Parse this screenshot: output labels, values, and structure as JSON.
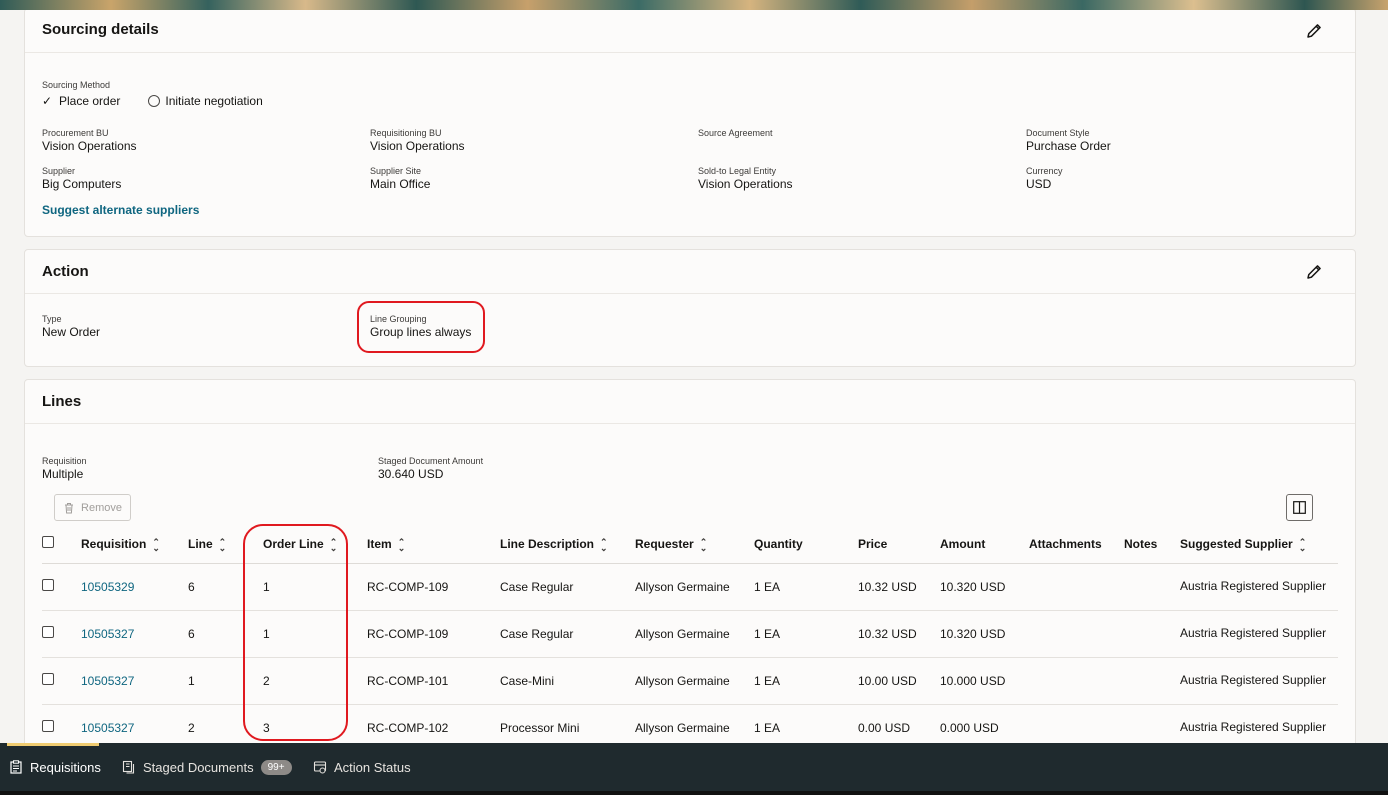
{
  "sourcing": {
    "title": "Sourcing details",
    "method_label": "Sourcing Method",
    "option_selected": "Place order",
    "option_other": "Initiate negotiation",
    "fields": [
      {
        "label": "Procurement BU",
        "value": "Vision Operations"
      },
      {
        "label": "Requisitioning BU",
        "value": "Vision Operations"
      },
      {
        "label": "Source Agreement",
        "value": ""
      },
      {
        "label": "Document Style",
        "value": "Purchase Order"
      },
      {
        "label": "Supplier",
        "value": "Big Computers"
      },
      {
        "label": "Supplier Site",
        "value": "Main Office"
      },
      {
        "label": "Sold-to Legal Entity",
        "value": "Vision Operations"
      },
      {
        "label": "Currency",
        "value": "USD"
      }
    ],
    "suggest_link": "Suggest alternate suppliers"
  },
  "action": {
    "title": "Action",
    "type_label": "Type",
    "type_value": "New Order",
    "grouping_label": "Line Grouping",
    "grouping_value": "Group lines always"
  },
  "lines": {
    "title": "Lines",
    "requisition_label": "Requisition",
    "requisition_value": "Multiple",
    "amount_label": "Staged Document Amount",
    "amount_value": "30.640 USD",
    "remove_label": "Remove",
    "columns": [
      "Requisition",
      "Line",
      "Order Line",
      "Item",
      "Line Description",
      "Requester",
      "Quantity",
      "Price",
      "Amount",
      "Attachments",
      "Notes",
      "Suggested Supplier"
    ],
    "rows": [
      {
        "requisition": "10505329",
        "line": "6",
        "order_line": "1",
        "item": "RC-COMP-109",
        "description": "Case Regular",
        "requester": "Allyson Germaine",
        "quantity": "1 EA",
        "price": "10.32 USD",
        "amount": "10.320 USD",
        "supplier": "Austria Registered Supplier"
      },
      {
        "requisition": "10505327",
        "line": "6",
        "order_line": "1",
        "item": "RC-COMP-109",
        "description": "Case Regular",
        "requester": "Allyson Germaine",
        "quantity": "1 EA",
        "price": "10.32 USD",
        "amount": "10.320 USD",
        "supplier": "Austria Registered Supplier"
      },
      {
        "requisition": "10505327",
        "line": "1",
        "order_line": "2",
        "item": "RC-COMP-101",
        "description": "Case-Mini",
        "requester": "Allyson Germaine",
        "quantity": "1 EA",
        "price": "10.00 USD",
        "amount": "10.000 USD",
        "supplier": "Austria Registered Supplier"
      },
      {
        "requisition": "10505327",
        "line": "2",
        "order_line": "3",
        "item": "RC-COMP-102",
        "description": "Processor Mini",
        "requester": "Allyson Germaine",
        "quantity": "1 EA",
        "price": "0.00 USD",
        "amount": "0.000 USD",
        "supplier": "Austria Registered Supplier"
      }
    ]
  },
  "bottom_tabs": [
    {
      "label": "Requisitions",
      "icon": "clipboard-icon"
    },
    {
      "label": "Staged Documents",
      "icon": "documents-icon",
      "badge": "99+"
    },
    {
      "label": "Action Status",
      "icon": "status-icon"
    }
  ],
  "colors": {
    "link": "#0f6680",
    "highlight": "#e0191f",
    "bottom_bar": "#1f2a2e"
  }
}
